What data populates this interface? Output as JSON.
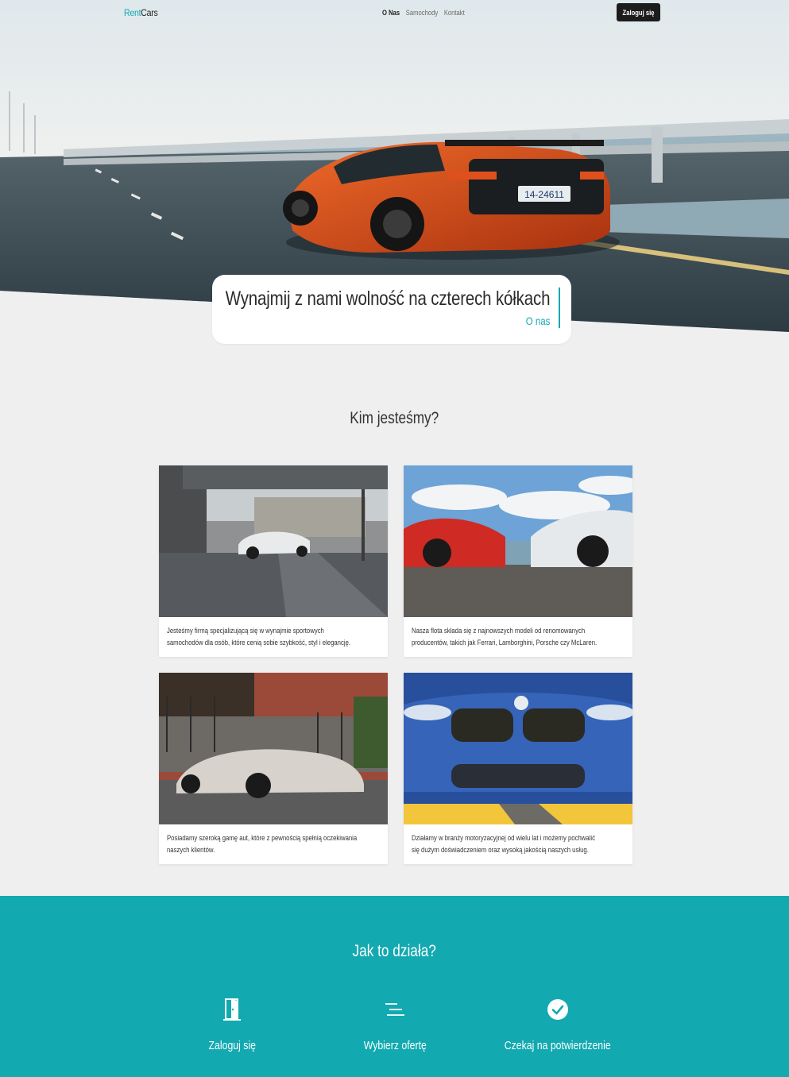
{
  "nav": {
    "logo_part1": "Rent",
    "logo_part2": "Cars",
    "links": [
      "O Nas",
      "Samochody",
      "Kontakt"
    ],
    "login_label": "Zaloguj się"
  },
  "hero": {
    "heading": "Wynajmij z nami wolność na czterech kółkach",
    "link_label": "O nas"
  },
  "about": {
    "title": "Kim jesteśmy?",
    "cards": [
      {
        "text": "Jesteśmy firmą specjalizującą się w wynajmie sportowych samochodów dla osób, które cenią sobie szybkość, styl i elegancję."
      },
      {
        "text": "Nasza flota składa się z najnowszych modeli od renomowanych producentów, takich jak Ferrari, Lamborghini, Porsche czy McLaren."
      },
      {
        "text": "Posiadamy szeroką gamę aut, które z pewnością spełnią oczekiwania naszych klientów."
      },
      {
        "text": "Działamy w branży motoryzacyjnej od wielu lat i możemy pochwalić się dużym doświadczeniem oraz wysoką jakością naszych usług."
      }
    ]
  },
  "how": {
    "title": "Jak to działa?",
    "steps": [
      {
        "label": "Zaloguj się",
        "icon": "door-icon"
      },
      {
        "label": "Wybierz ofertę",
        "icon": "list-icon"
      },
      {
        "label": "Czekaj na potwierdzenie",
        "icon": "check-circle-icon"
      }
    ]
  },
  "colors": {
    "accent": "#13a8b3",
    "dark": "#1c1c1c",
    "section_bg": "#12a9b0"
  }
}
